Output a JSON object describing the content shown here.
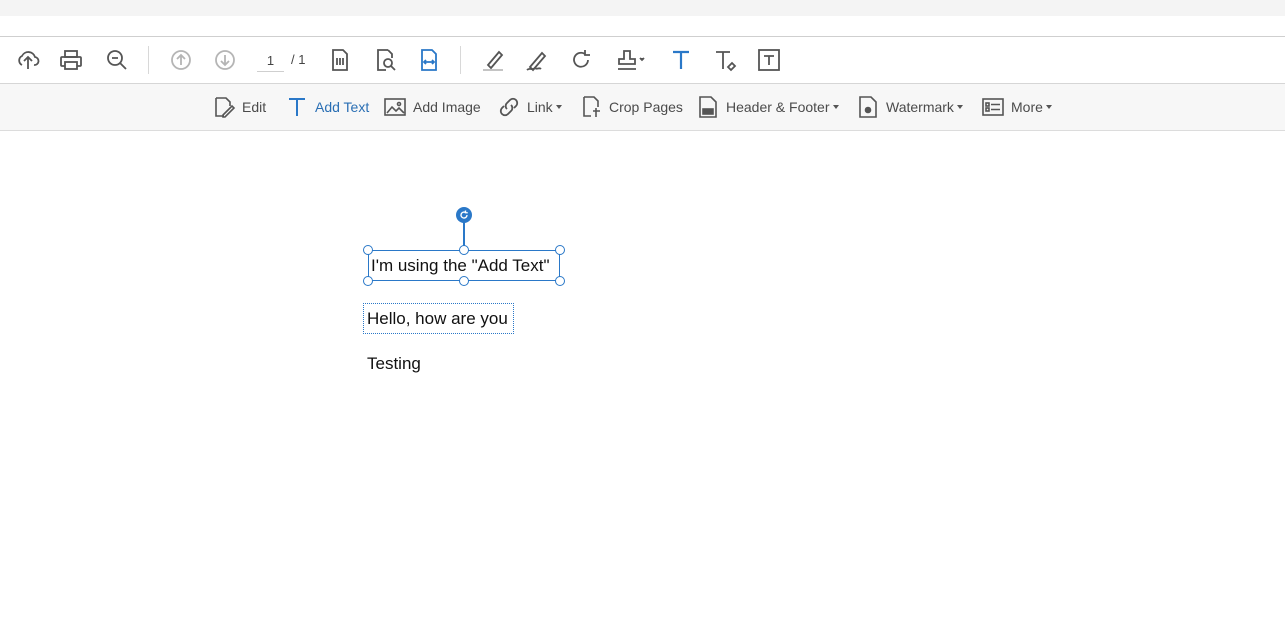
{
  "toolbar": {
    "page_current": "1",
    "page_total": "/ 1",
    "buttons": [
      {
        "name": "upload-icon"
      },
      {
        "name": "print-icon"
      },
      {
        "name": "zoom-out-icon"
      },
      {
        "name": "page-up-icon"
      },
      {
        "name": "page-down-icon"
      },
      {
        "name": "fit-page-icon"
      },
      {
        "name": "zoom-page-icon"
      },
      {
        "name": "fit-width-icon"
      },
      {
        "name": "highlight-icon"
      },
      {
        "name": "sign-icon"
      },
      {
        "name": "rotate-icon"
      },
      {
        "name": "stamp-icon"
      },
      {
        "name": "add-text-icon"
      },
      {
        "name": "clear-format-icon"
      },
      {
        "name": "text-box-icon"
      }
    ]
  },
  "edit_bar": {
    "edit": "Edit",
    "add_text": "Add Text",
    "add_image": "Add Image",
    "link": "Link",
    "crop_pages": "Crop Pages",
    "header_footer": "Header & Footer",
    "watermark": "Watermark",
    "more": "More"
  },
  "canvas": {
    "text_selected": "I'm using the \"Add Text\"",
    "text_dotted": "Hello, how are you",
    "text_plain": "Testing"
  },
  "colors": {
    "accent": "#2a78c8",
    "icon": "#555555",
    "disabled_icon": "#b5b5b5"
  }
}
